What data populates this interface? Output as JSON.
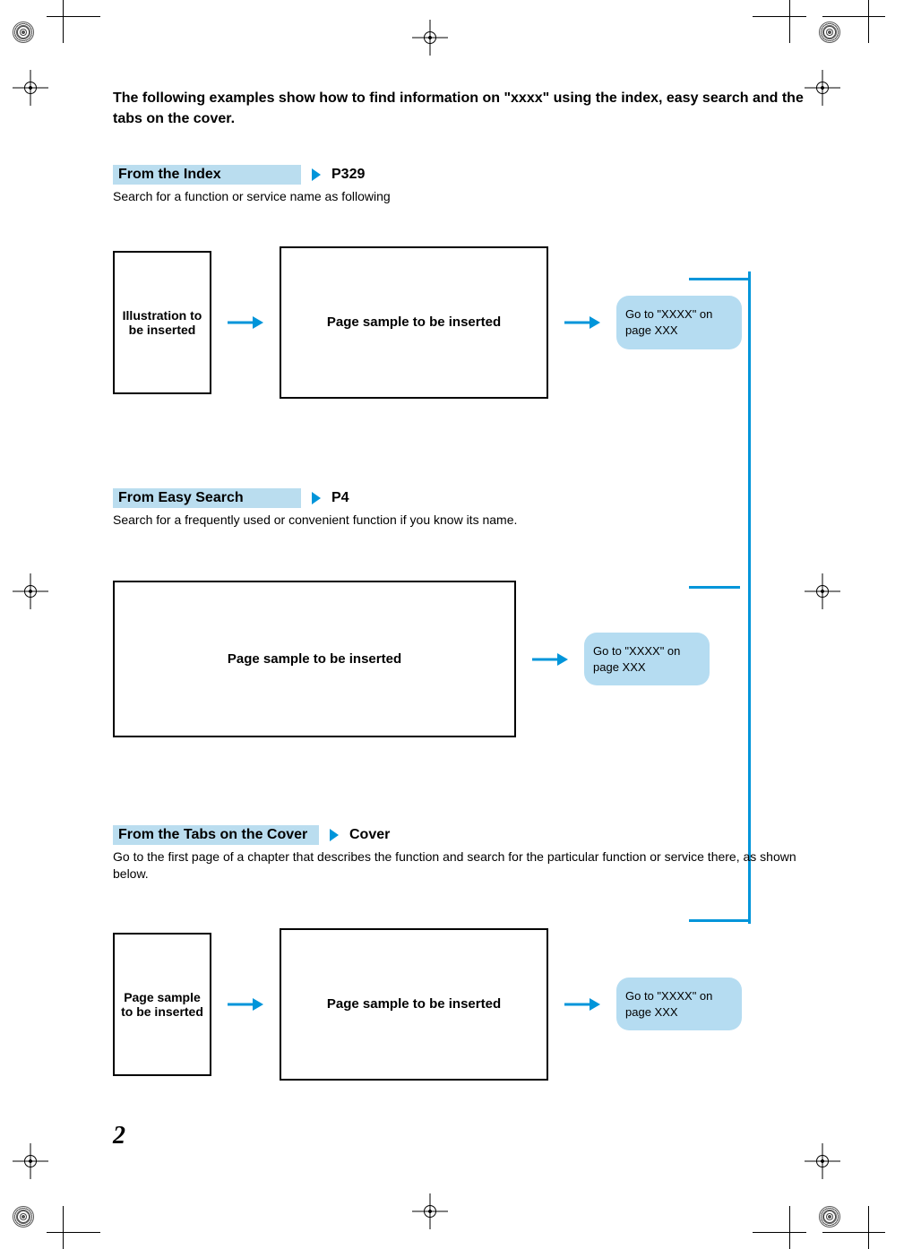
{
  "intro": "The following examples show how to find information on \"xxxx\" using the index, easy search and the tabs on the cover.",
  "sections": [
    {
      "label": "From the Index",
      "ref": "P329",
      "desc": "Search for a function or service name as following",
      "small_box": "Illustration to be inserted",
      "big_box": "Page sample to be inserted",
      "goto": "Go to \"XXXX\" on page XXX"
    },
    {
      "label": "From Easy Search",
      "ref": "P4",
      "desc": "Search for a frequently used or convenient function if you know its name.",
      "big_box": "Page sample to be inserted",
      "goto": "Go to \"XXXX\" on page XXX"
    },
    {
      "label": "From the Tabs on the Cover",
      "ref": "Cover",
      "desc": "Go to the first page of a chapter that describes the function and search for the particular function or service there, as shown below.",
      "small_box": "Page sample to be inserted",
      "big_box": "Page sample to be inserted",
      "goto": "Go to \"XXXX\" on page XXX"
    }
  ],
  "page_number": "2"
}
